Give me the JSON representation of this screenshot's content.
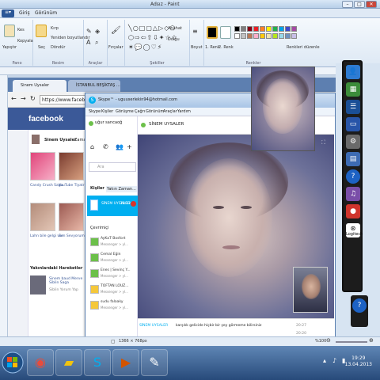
{
  "paint": {
    "title": "Adsız - Paint",
    "tabs": [
      "Giriş",
      "Görünüm"
    ],
    "groups": [
      "Pano",
      "Resim",
      "Araçlar",
      "Şekiller",
      "Renkler"
    ],
    "clipboard": {
      "paste": "Yapıştır",
      "cut": "Kes",
      "copy": "Kopyala"
    },
    "image": {
      "select": "Seç",
      "crop": "Kırp",
      "resize": "Yeniden boyutlandır",
      "rotate": "Döndür"
    },
    "brushes": "Fırçalar",
    "outline": "Anahat",
    "fill": "Dolgu",
    "size": "Boyut",
    "color1": "1. Renk",
    "color2": "2. Renk",
    "edit_colors": "Renkleri düzenle",
    "status_size": "1366 × 768px",
    "zoom": "%100"
  },
  "chrome": {
    "tabs": [
      "Sinem Uysaler",
      "İSTANBUL BEŞİKTAŞ ..."
    ],
    "url": "https://www.facebook.com"
  },
  "facebook": {
    "logo": "facebook",
    "profile_name": "Sinem Uysaler",
    "profile_short": "Zaman",
    "apps": [
      "Candy Crush Saga",
      "YouTube Tiyatr",
      "Lahn bile gelgi var",
      "Sen Sevyorum"
    ],
    "recent_heading": "Yakınlardaki Hareketler",
    "recent_item": "Sinem baud Merve Siblin Saga",
    "recent_sub": "Siblin Yorum Yap"
  },
  "skype": {
    "title": "Skype™ - uguuserlekin94@hotmail.com",
    "menu": [
      "Skype",
      "Kişiler",
      "Görüşme",
      "Çağrı",
      "Görünüm",
      "Araçlar",
      "Yardım"
    ],
    "user": "uğur sarıcaoğ",
    "search_placeholder": "Ara",
    "tabs": [
      "Kişiler",
      "Yakın Zaman..."
    ],
    "active_contact": "SİNEM UYSALER",
    "active_time": "18:12",
    "online_heading": "Çevrimiçi",
    "contacts": [
      {
        "name": "AyKaT Bosfort",
        "sub": "Messenger > yl..."
      },
      {
        "name": "Cemal Eğin",
        "sub": "Messenger > yl..."
      },
      {
        "name": "Enes | Sevinç Y...",
        "sub": "Messenger > yl..."
      },
      {
        "name": "TOFTAN LOUZ...",
        "sub": "Messenger > yl..."
      },
      {
        "name": "sudu falaaky",
        "sub": "Messenger > yl..."
      }
    ],
    "conversation_name": "SİNEM UYSALER",
    "chat_sender": "SİNEM UYSALER",
    "chat_message": "karşılık gelicide hiçbir bir şey görmeme bilirsiniz",
    "chat_time": "20:27",
    "chat_time2": "20:20"
  },
  "dock": {
    "logitech_label": "Logitech"
  },
  "taskbar": {
    "time": "19:29",
    "date": "13.04.2013"
  }
}
